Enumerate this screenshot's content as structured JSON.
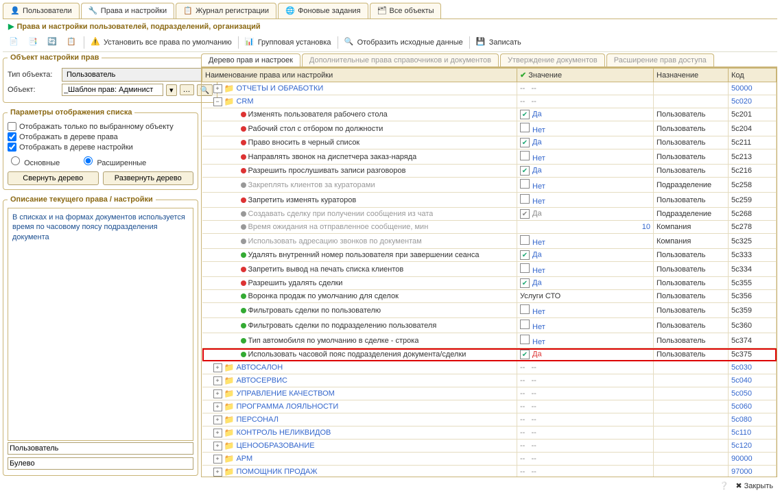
{
  "topTabs": [
    {
      "label": "Пользователи",
      "icon": "👤"
    },
    {
      "label": "Права и настройки",
      "icon": "🔧",
      "active": true
    },
    {
      "label": "Журнал регистрации",
      "icon": "📋"
    },
    {
      "label": "Фоновые задания",
      "icon": "🌐"
    },
    {
      "label": "Все объекты",
      "icon": "🗂"
    }
  ],
  "subtitle": "Права и настройки пользователей, подразделений, организаций",
  "toolbar": {
    "setDefault": "Установить все права по умолчанию",
    "groupSet": "Групповая установка",
    "showSource": "Отобразить исходные данные",
    "save": "Записать"
  },
  "leftPanel": {
    "objGroup": "Объект настройки прав",
    "typeLabel": "Тип объекта:",
    "typeValue": "Пользователь",
    "objLabel": "Объект:",
    "objValue": "_Шаблон прав: Админист",
    "paramsGroup": "Параметры отображения списка",
    "chkBySelected": "Отображать только по выбранному объекту",
    "chkBySelectedVal": false,
    "chkRights": "Отображать в дереве права",
    "chkRightsVal": true,
    "chkSettings": "Отображать в дереве настройки",
    "chkSettingsVal": true,
    "radioBasic": "Основные",
    "radioExt": "Расширенные",
    "btnCollapse": "Свернуть дерево",
    "btnExpand": "Развернуть дерево",
    "descGroup": "Описание текущего права / настройки",
    "descText": "В списках и на формах документов используется время по часовому поясу подразделения документа",
    "bottom1": "Пользователь",
    "bottom2": "Булево"
  },
  "innerTabs": [
    {
      "label": "Дерево прав и настроек",
      "active": true
    },
    {
      "label": "Дополнительные права справочников и документов"
    },
    {
      "label": "Утверждение документов"
    },
    {
      "label": "Расширение прав доступа"
    }
  ],
  "grid": {
    "headers": {
      "name": "Наименование права или настройки",
      "value": "Значение",
      "assign": "Назначение",
      "code": "Код"
    },
    "rows": [
      {
        "type": "folder",
        "exp": "+",
        "indent": 0,
        "name": "ОТЧЕТЫ И ОБРАБОТКИ",
        "val": "--",
        "assign": "",
        "code": "50000"
      },
      {
        "type": "folder",
        "exp": "-",
        "indent": 0,
        "name": "CRM",
        "val": "--",
        "assign": "",
        "code": "5c020"
      },
      {
        "type": "leaf",
        "dot": "red",
        "indent": 1,
        "name": "Изменять пользователя рабочего стола",
        "chk": true,
        "val": "Да",
        "assign": "Пользователь",
        "code": "5c201"
      },
      {
        "type": "leaf",
        "dot": "red",
        "indent": 1,
        "name": "Рабочий стол с отбором по должности",
        "chk": false,
        "val": "Нет",
        "assign": "Пользователь",
        "code": "5c204"
      },
      {
        "type": "leaf",
        "dot": "red",
        "indent": 1,
        "name": "Право вносить в черный список",
        "chk": true,
        "val": "Да",
        "assign": "Пользователь",
        "code": "5c211"
      },
      {
        "type": "leaf",
        "dot": "red",
        "indent": 1,
        "name": "Направлять звонок на диспетчера заказ-наряда",
        "chk": false,
        "val": "Нет",
        "assign": "Пользователь",
        "code": "5c213"
      },
      {
        "type": "leaf",
        "dot": "red",
        "indent": 1,
        "name": "Разрешить прослушивать записи разговоров",
        "chk": true,
        "val": "Да",
        "assign": "Пользователь",
        "code": "5c216"
      },
      {
        "type": "leaf",
        "dot": "gray",
        "indent": 1,
        "name": "Закреплять клиентов за кураторами",
        "disabled": true,
        "chk": false,
        "val": "Нет",
        "assign": "Подразделение",
        "code": "5c258"
      },
      {
        "type": "leaf",
        "dot": "red",
        "indent": 1,
        "name": "Запретить изменять кураторов",
        "chk": false,
        "val": "Нет",
        "assign": "Пользователь",
        "code": "5c259"
      },
      {
        "type": "leaf",
        "dot": "gray",
        "indent": 1,
        "name": "Создавать сделку при получении сообщения из чата",
        "disabled": true,
        "chkgray": true,
        "val": "Да",
        "valgray": true,
        "assign": "Подразделение",
        "code": "5c268"
      },
      {
        "type": "leaf",
        "dot": "gray",
        "indent": 1,
        "name": "Время ожидания на отправленное сообщение, мин",
        "disabled": true,
        "num": "10",
        "assign": "Компания",
        "code": "5c278"
      },
      {
        "type": "leaf",
        "dot": "gray",
        "indent": 1,
        "name": "Использовать адресацию звонков по документам",
        "disabled": true,
        "chk": false,
        "val": "Нет",
        "assign": "Компания",
        "code": "5c325"
      },
      {
        "type": "leaf",
        "dot": "green",
        "indent": 1,
        "name": "Удалять внутренний номер пользователя при завершении сеанса",
        "chk": true,
        "val": "Да",
        "assign": "Пользователь",
        "code": "5c333"
      },
      {
        "type": "leaf",
        "dot": "red",
        "indent": 1,
        "name": "Запретить вывод на печать списка клиентов",
        "chk": false,
        "val": "Нет",
        "assign": "Пользователь",
        "code": "5c334"
      },
      {
        "type": "leaf",
        "dot": "red",
        "indent": 1,
        "name": "Разрешить удалять сделки",
        "chk": true,
        "val": "Да",
        "assign": "Пользователь",
        "code": "5c355"
      },
      {
        "type": "leaf",
        "dot": "green",
        "indent": 1,
        "name": "Воронка продаж по умолчанию для сделок",
        "text": "Услуги СТО",
        "assign": "Пользователь",
        "code": "5c356"
      },
      {
        "type": "leaf",
        "dot": "green",
        "indent": 1,
        "name": "Фильтровать сделки по пользователю",
        "chk": false,
        "val": "Нет",
        "assign": "Пользователь",
        "code": "5c359"
      },
      {
        "type": "leaf",
        "dot": "green",
        "indent": 1,
        "name": "Фильтровать сделки по подразделению пользователя",
        "chk": false,
        "val": "Нет",
        "assign": "Пользователь",
        "code": "5c360"
      },
      {
        "type": "leaf",
        "dot": "green",
        "indent": 1,
        "name": "Тип автомобиля по умолчанию в сделке - строка",
        "chk": false,
        "val": "Нет",
        "assign": "Пользователь",
        "code": "5c374"
      },
      {
        "type": "leaf",
        "dot": "green",
        "indent": 1,
        "name": "Использовать часовой пояс подразделения документа/сделки",
        "chk": true,
        "val": "Да",
        "valred": true,
        "assign": "Пользователь",
        "code": "5c375",
        "highlight": true
      },
      {
        "type": "folder",
        "exp": "+",
        "indent": 0,
        "name": "АВТОСАЛОН",
        "val": "--",
        "assign": "",
        "code": "5c030"
      },
      {
        "type": "folder",
        "exp": "+",
        "indent": 0,
        "name": "АВТОСЕРВИС",
        "val": "--",
        "assign": "",
        "code": "5c040"
      },
      {
        "type": "folder",
        "exp": "+",
        "indent": 0,
        "name": "УПРАВЛЕНИЕ КАЧЕСТВОМ",
        "val": "--",
        "assign": "",
        "code": "5c050"
      },
      {
        "type": "folder",
        "exp": "+",
        "indent": 0,
        "name": "ПРОГРАММА ЛОЯЛЬНОСТИ",
        "val": "--",
        "assign": "",
        "code": "5c060"
      },
      {
        "type": "folder",
        "exp": "+",
        "indent": 0,
        "name": "ПЕРСОНАЛ",
        "val": "--",
        "assign": "",
        "code": "5c080"
      },
      {
        "type": "folder",
        "exp": "+",
        "indent": 0,
        "name": "КОНТРОЛЬ НЕЛИКВИДОВ",
        "val": "--",
        "assign": "",
        "code": "5c110"
      },
      {
        "type": "folder",
        "exp": "+",
        "indent": 0,
        "name": "ЦЕНООБРАЗОВАНИЕ",
        "val": "--",
        "assign": "",
        "code": "5c120"
      },
      {
        "type": "folder",
        "exp": "+",
        "indent": 0,
        "name": "АРМ",
        "val": "--",
        "assign": "",
        "code": "90000"
      },
      {
        "type": "folder",
        "exp": "+",
        "indent": 0,
        "name": "ПОМОЩНИК ПРОДАЖ",
        "val": "--",
        "assign": "",
        "code": "97000"
      }
    ]
  },
  "footer": {
    "help": "Закрыть",
    "close": "Закрыть"
  }
}
